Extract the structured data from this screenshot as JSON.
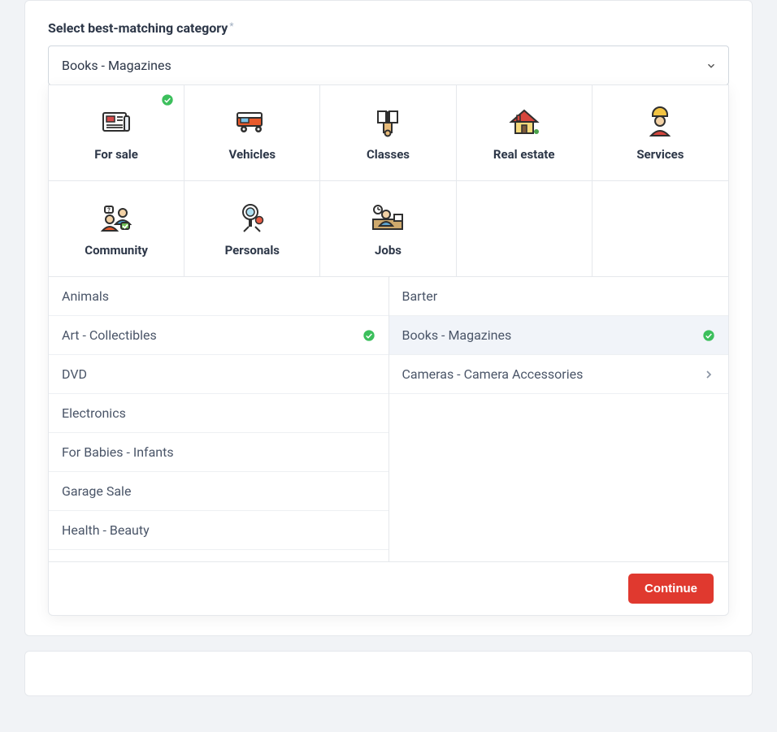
{
  "field_label": "Select best-matching category",
  "required_mark": "*",
  "selected_value": "Books - Magazines",
  "top_categories": [
    {
      "label": "For sale",
      "checked": true
    },
    {
      "label": "Vehicles",
      "checked": false
    },
    {
      "label": "Classes",
      "checked": false
    },
    {
      "label": "Real estate",
      "checked": false
    },
    {
      "label": "Services",
      "checked": false
    },
    {
      "label": "Community",
      "checked": false
    },
    {
      "label": "Personals",
      "checked": false
    },
    {
      "label": "Jobs",
      "checked": false
    }
  ],
  "sub_left": [
    {
      "label": "Animals"
    },
    {
      "label": "Art - Collectibles",
      "checked": true
    },
    {
      "label": "DVD"
    },
    {
      "label": "Electronics"
    },
    {
      "label": "For Babies - Infants"
    },
    {
      "label": "Garage Sale"
    },
    {
      "label": "Health - Beauty"
    }
  ],
  "sub_right": [
    {
      "label": "Barter"
    },
    {
      "label": "Books - Magazines",
      "checked": true,
      "highlight": true
    },
    {
      "label": "Cameras - Camera Accessories",
      "chevron": true
    }
  ],
  "continue_label": "Continue"
}
